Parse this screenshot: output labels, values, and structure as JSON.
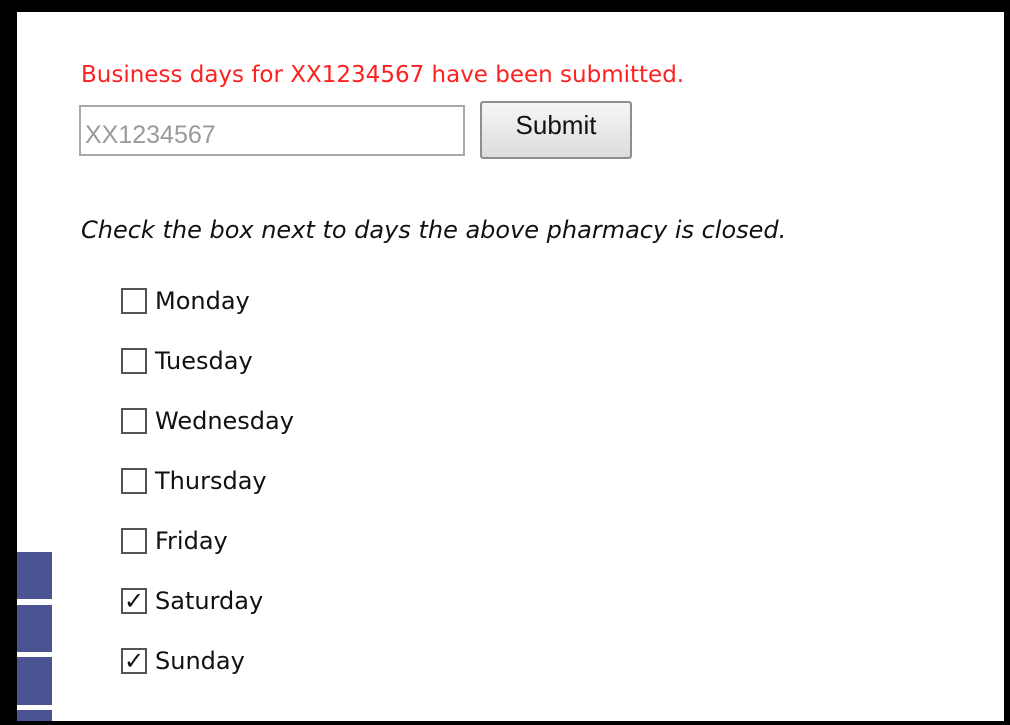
{
  "status_message": "Business days for XX1234567 have been submitted.",
  "pharmacy_id": {
    "value": "",
    "placeholder": "XX1234567"
  },
  "submit_label": "Submit",
  "instructions": "Check the box next to days the above pharmacy is closed.",
  "days": [
    {
      "label": "Monday",
      "checked": false
    },
    {
      "label": "Tuesday",
      "checked": false
    },
    {
      "label": "Wednesday",
      "checked": false
    },
    {
      "label": "Thursday",
      "checked": false
    },
    {
      "label": "Friday",
      "checked": false
    },
    {
      "label": "Saturday",
      "checked": true
    },
    {
      "label": "Sunday",
      "checked": true
    }
  ],
  "colors": {
    "status": "#ff2020",
    "side_tab": "#4b5393",
    "frame": "#000000"
  }
}
